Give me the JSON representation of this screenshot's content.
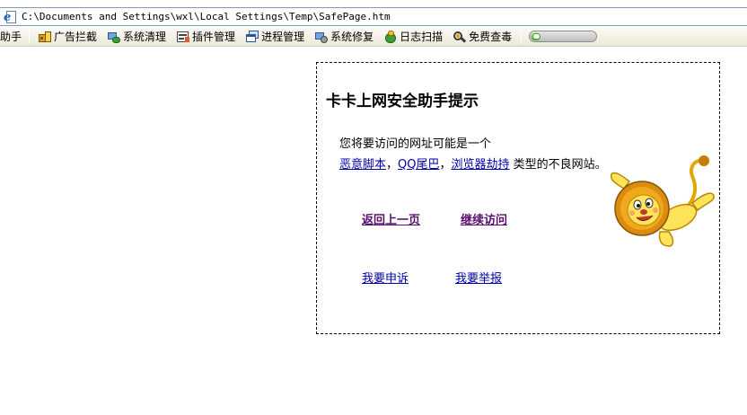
{
  "address_bar": {
    "url": "C:\\Documents and Settings\\wxl\\Local Settings\\Temp\\SafePage.htm",
    "icon": "ie-page-icon"
  },
  "toolbar": {
    "partial_label": "助手",
    "buttons": [
      {
        "label": "广告拦截",
        "icon": "ad-block-icon"
      },
      {
        "label": "系统清理",
        "icon": "system-clean-icon"
      },
      {
        "label": "插件管理",
        "icon": "plugin-manage-icon"
      },
      {
        "label": "进程管理",
        "icon": "process-manage-icon"
      },
      {
        "label": "系统修复",
        "icon": "system-repair-icon"
      },
      {
        "label": "日志扫描",
        "icon": "log-scan-icon"
      },
      {
        "label": "免费查毒",
        "icon": "virus-scan-icon"
      }
    ],
    "progress": 0.15
  },
  "warning": {
    "title": "卡卡上网安全助手提示",
    "line1": "您将要访问的网址可能是一个",
    "types": [
      "恶意脚本",
      "QQ尾巴",
      "浏览器劫持"
    ],
    "comma": "，",
    "line2_suffix": " 类型的不良网站。",
    "back_label": "返回上一页",
    "continue_label": "继续访问",
    "complain_label": "我要申诉",
    "report_label": "我要举报",
    "mascot_icon": "lion-mascot-icon"
  },
  "colors": {
    "link": "#0000aa",
    "visited_link": "#5a0f6e",
    "progress_green": "#3cbc2c"
  }
}
